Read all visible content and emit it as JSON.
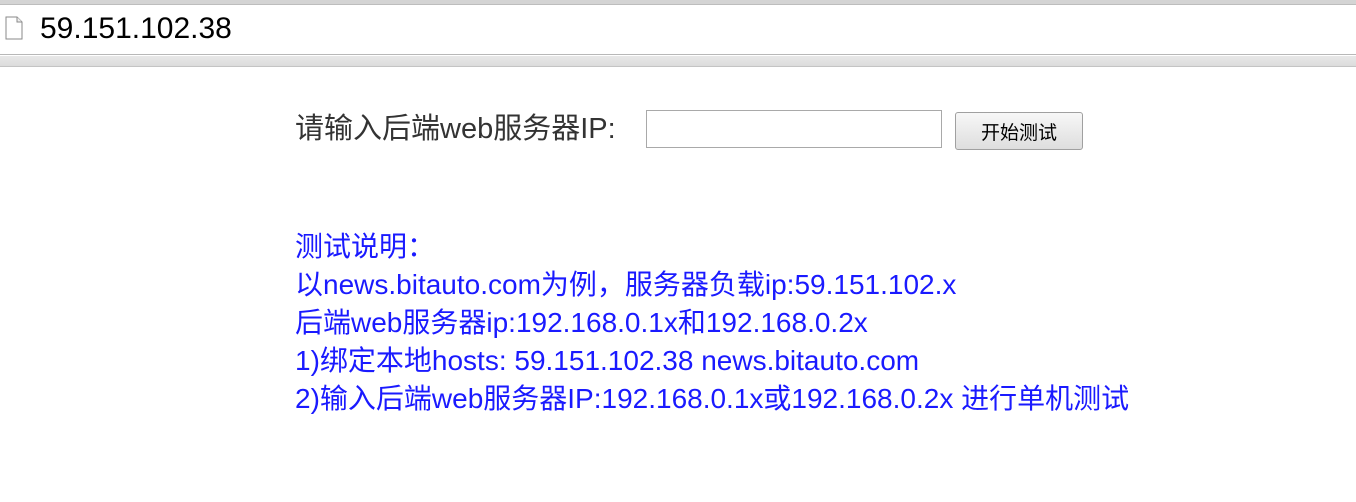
{
  "browser": {
    "url": "59.151.102.38",
    "page_icon": "page-icon"
  },
  "form": {
    "label": "请输入后端web服务器IP:",
    "input_value": "",
    "input_placeholder": "",
    "button_label": "开始测试"
  },
  "description": {
    "title": "测试说明：",
    "lines": [
      "以news.bitauto.com为例，服务器负载ip:59.151.102.x",
      "后端web服务器ip:192.168.0.1x和192.168.0.2x",
      "1)绑定本地hosts: 59.151.102.38 news.bitauto.com",
      "2)输入后端web服务器IP:192.168.0.1x或192.168.0.2x 进行单机测试"
    ]
  },
  "colors": {
    "description_text": "#1a1aff",
    "label_text": "#333333"
  }
}
